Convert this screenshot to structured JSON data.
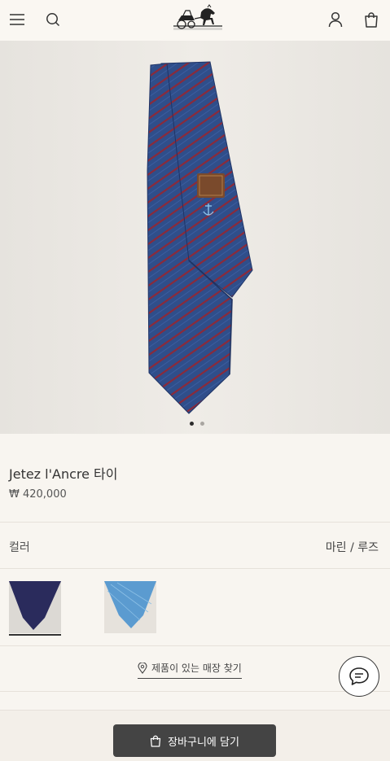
{
  "header": {
    "menu_icon": "hamburger-menu-icon",
    "search_icon": "search-icon",
    "logo": "hermes-carriage-logo",
    "account_icon": "user-account-icon",
    "bag_icon": "shopping-bag-icon"
  },
  "gallery": {
    "image": "blue navy tie with red diagonal stripes and anchor motif",
    "slide_count": 2,
    "active_slide": 1
  },
  "product": {
    "title": "Jetez l'Ancre 타이",
    "price": "₩ 420,000"
  },
  "color": {
    "label": "컬러",
    "selected": "마린 / 루즈",
    "swatches": [
      {
        "name": "navy",
        "selected": true,
        "main": "#2a2b5c",
        "bg": "#dcd9d4"
      },
      {
        "name": "light-blue",
        "selected": false,
        "main": "#5b9bd0",
        "bg": "#e6e2dc"
      }
    ]
  },
  "store_finder": {
    "label": "제품이 있는 매장 찾기",
    "icon": "location-pin-icon"
  },
  "chat": {
    "icon": "chat-bubble-icon"
  },
  "cart": {
    "label": "장바구니에 담기",
    "icon": "shopping-bag-icon"
  },
  "colors": {
    "background": "#f8f5f0",
    "button": "#444444",
    "tie_blue": "#2f4e8a",
    "tie_red": "#8b2a3a"
  }
}
